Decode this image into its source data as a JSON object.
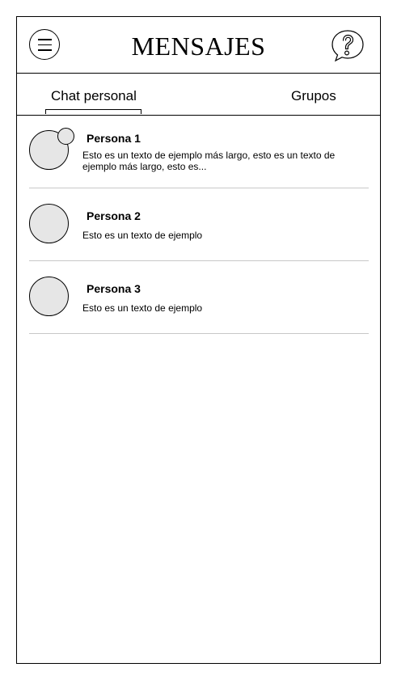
{
  "header": {
    "title": "MENSAJES",
    "menu_icon": "hamburger-menu-icon",
    "help_icon": "help-chat-bubble-icon"
  },
  "tabs": [
    {
      "label": "Chat personal",
      "active": true
    },
    {
      "label": "Grupos",
      "active": false
    }
  ],
  "chats": [
    {
      "name": "Persona 1",
      "message": "Esto es un texto de ejemplo más largo, esto es un texto de ejemplo más largo, esto es...",
      "has_badge": true
    },
    {
      "name": "Persona 2",
      "message": "Esto es un texto de ejemplo",
      "has_badge": false
    },
    {
      "name": "Persona 3",
      "message": "Esto es un texto de ejemplo",
      "has_badge": false
    }
  ],
  "colors": {
    "border": "#000000",
    "avatar_fill": "#e6e6e6",
    "separator": "#c8c8c8",
    "background": "#ffffff"
  }
}
